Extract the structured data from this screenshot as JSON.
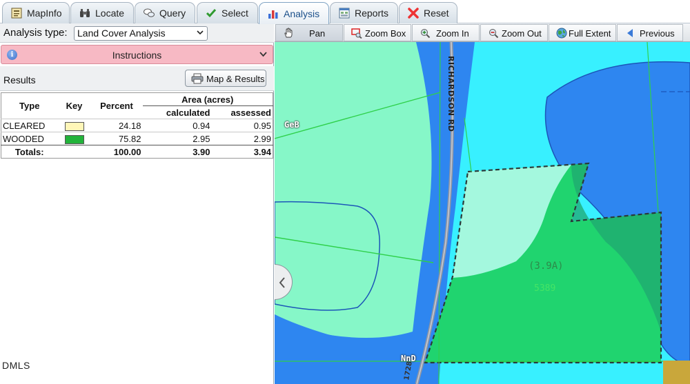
{
  "tabs": [
    {
      "label": "MapInfo",
      "icon": "map-info-icon",
      "active": false
    },
    {
      "label": "Locate",
      "icon": "binoculars-icon",
      "active": false
    },
    {
      "label": "Query",
      "icon": "speech-bubbles-icon",
      "active": false
    },
    {
      "label": "Select",
      "icon": "checkmark-icon",
      "active": false
    },
    {
      "label": "Analysis",
      "icon": "bar-chart-icon",
      "active": true
    },
    {
      "label": "Reports",
      "icon": "report-icon",
      "active": false
    },
    {
      "label": "Reset",
      "icon": "red-x-icon",
      "active": false
    }
  ],
  "analysis": {
    "label": "Analysis type:",
    "selected": "Land Cover Analysis"
  },
  "instructions": {
    "label": "Instructions"
  },
  "results": {
    "label": "Results",
    "button_label": "Map & Results",
    "table": {
      "headers": {
        "type": "Type",
        "key": "Key",
        "percent": "Percent",
        "area": "Area (acres)",
        "calculated": "calculated",
        "assessed": "assessed"
      },
      "rows": [
        {
          "type": "CLEARED",
          "key_color": "#fff6b8",
          "percent": "24.18",
          "calculated": "0.94",
          "assessed": "0.95"
        },
        {
          "type": "WOODED",
          "key_color": "#22b33a",
          "percent": "75.82",
          "calculated": "2.95",
          "assessed": "2.99"
        }
      ],
      "totals": {
        "label": "Totals:",
        "percent": "100.00",
        "calculated": "3.90",
        "assessed": "3.94"
      }
    }
  },
  "footer": {
    "text": "DMLS"
  },
  "toolbar": {
    "buttons": [
      {
        "label": "Pan",
        "icon": "hand-icon",
        "active": true
      },
      {
        "label": "Zoom Box",
        "icon": "zoom-box-icon",
        "active": false
      },
      {
        "label": "Zoom In",
        "icon": "zoom-in-icon",
        "active": false
      },
      {
        "label": "Zoom Out",
        "icon": "zoom-out-icon",
        "active": false
      },
      {
        "label": "Full Extent",
        "icon": "globe-icon",
        "active": false
      },
      {
        "label": "Previous",
        "icon": "triangle-left-icon",
        "active": false
      }
    ]
  },
  "map": {
    "road_label": "RICHARDSON RD",
    "soil_label_1": "GeB",
    "soil_label_2": "NnD",
    "route_label": "1728",
    "parcel_area_label": "(3.9A)",
    "parcel_sublabel": "5389",
    "colors": {
      "deep_blue": "#2e86f0",
      "cyan": "#38f0ff",
      "mint": "#86f7c8",
      "wooded_green": "#20d46f",
      "cleared": "#a4f8de",
      "olive": "#c9a73b"
    }
  }
}
